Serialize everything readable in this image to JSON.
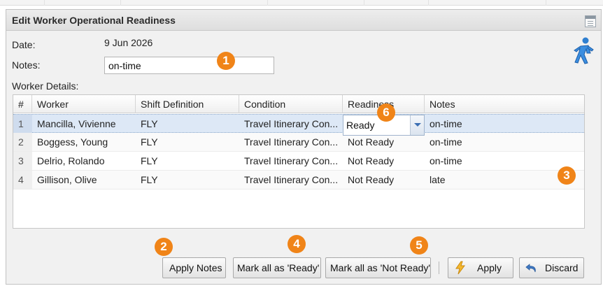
{
  "panel": {
    "title": "Edit Worker Operational Readiness"
  },
  "form": {
    "date_label": "Date:",
    "date_value": "9 Jun 2026",
    "notes_label": "Notes:",
    "notes_value": "on-time",
    "worker_details_label": "Worker Details:"
  },
  "grid": {
    "columns": [
      "#",
      "Worker",
      "Shift Definition",
      "Condition",
      "Readiness",
      "Notes"
    ],
    "rows": [
      {
        "num": "1",
        "worker": "Mancilla, Vivienne",
        "shift": "FLY",
        "condition": "Travel Itinerary Con...",
        "readiness": "Ready",
        "notes": "on-time"
      },
      {
        "num": "2",
        "worker": "Boggess, Young",
        "shift": "FLY",
        "condition": "Travel Itinerary Con...",
        "readiness": "Not Ready",
        "notes": "on-time"
      },
      {
        "num": "3",
        "worker": "Delrio, Rolando",
        "shift": "FLY",
        "condition": "Travel Itinerary Con...",
        "readiness": "Not Ready",
        "notes": "on-time"
      },
      {
        "num": "4",
        "worker": "Gillison, Olive",
        "shift": "FLY",
        "condition": "Travel Itinerary Con...",
        "readiness": "Not Ready",
        "notes": "late"
      }
    ],
    "editor_value": "Ready"
  },
  "buttons": {
    "apply_notes": "Apply Notes",
    "mark_ready": "Mark all as 'Ready'",
    "mark_not_ready": "Mark all as 'Not Ready'",
    "apply": "Apply",
    "discard": "Discard"
  },
  "badges": [
    "1",
    "2",
    "3",
    "4",
    "5",
    "6"
  ],
  "icons": {
    "header_tool": "form-icon",
    "person": "walking-person-icon",
    "apply": "lightning-icon",
    "discard": "undo-arrow-icon"
  },
  "colors": {
    "badge": "#f08418",
    "selected_row": "#dde8f6",
    "panel_bg": "#f1f1f1"
  }
}
